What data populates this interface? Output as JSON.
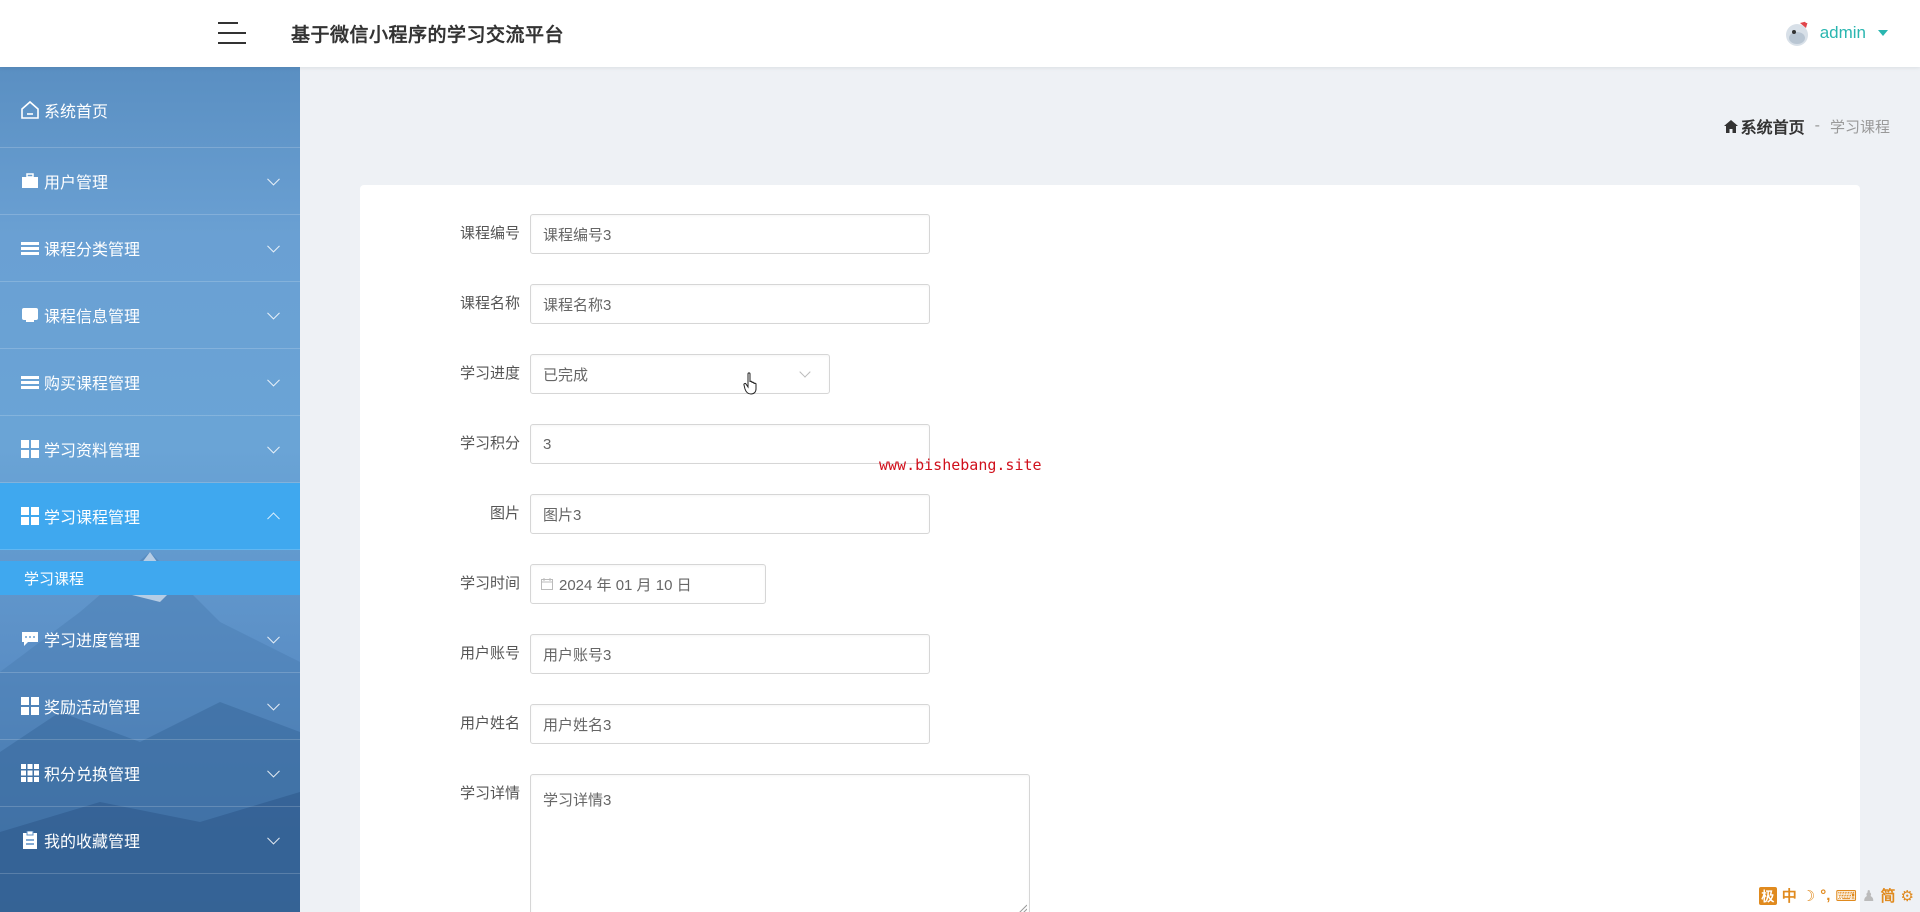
{
  "header": {
    "title": "基于微信小程序的学习交流平台",
    "user_name": "admin"
  },
  "sidebar": {
    "home_label": "系统首页",
    "items": [
      {
        "label": "用户管理",
        "icon": "briefcase-icon"
      },
      {
        "label": "课程分类管理",
        "icon": "list-icon"
      },
      {
        "label": "课程信息管理",
        "icon": "inbox-icon"
      },
      {
        "label": "购买课程管理",
        "icon": "list-icon"
      },
      {
        "label": "学习资料管理",
        "icon": "grid-icon"
      },
      {
        "label": "学习课程管理",
        "icon": "grid-icon",
        "active": true
      },
      {
        "label": "学习进度管理",
        "icon": "chat-icon"
      },
      {
        "label": "奖励活动管理",
        "icon": "grid-icon"
      },
      {
        "label": "积分兑换管理",
        "icon": "grid-9-icon"
      },
      {
        "label": "我的收藏管理",
        "icon": "clipboard-icon"
      }
    ],
    "active_sub_item": "学习课程"
  },
  "breadcrumb": {
    "home": "系统首页",
    "separator": "-",
    "current": "学习课程"
  },
  "form": {
    "course_no": {
      "label": "课程编号",
      "value": "课程编号3"
    },
    "course_name": {
      "label": "课程名称",
      "value": "课程名称3"
    },
    "progress": {
      "label": "学习进度",
      "value": "已完成"
    },
    "points": {
      "label": "学习积分",
      "value": "3"
    },
    "image": {
      "label": "图片",
      "value": "图片3"
    },
    "study_time": {
      "label": "学习时间",
      "value": "2024 年 01 月 10 日"
    },
    "account": {
      "label": "用户账号",
      "value": "用户账号3"
    },
    "user_name": {
      "label": "用户姓名",
      "value": "用户姓名3"
    },
    "details": {
      "label": "学习详情",
      "value": "学习详情3"
    }
  },
  "watermark": "www.bishebang.site",
  "tray": {
    "ime_mode": "中",
    "char_set": "简"
  },
  "colors": {
    "accent": "#2ab6b0",
    "sidebar_active": "#3fa8ef",
    "watermark": "#d0101c"
  }
}
